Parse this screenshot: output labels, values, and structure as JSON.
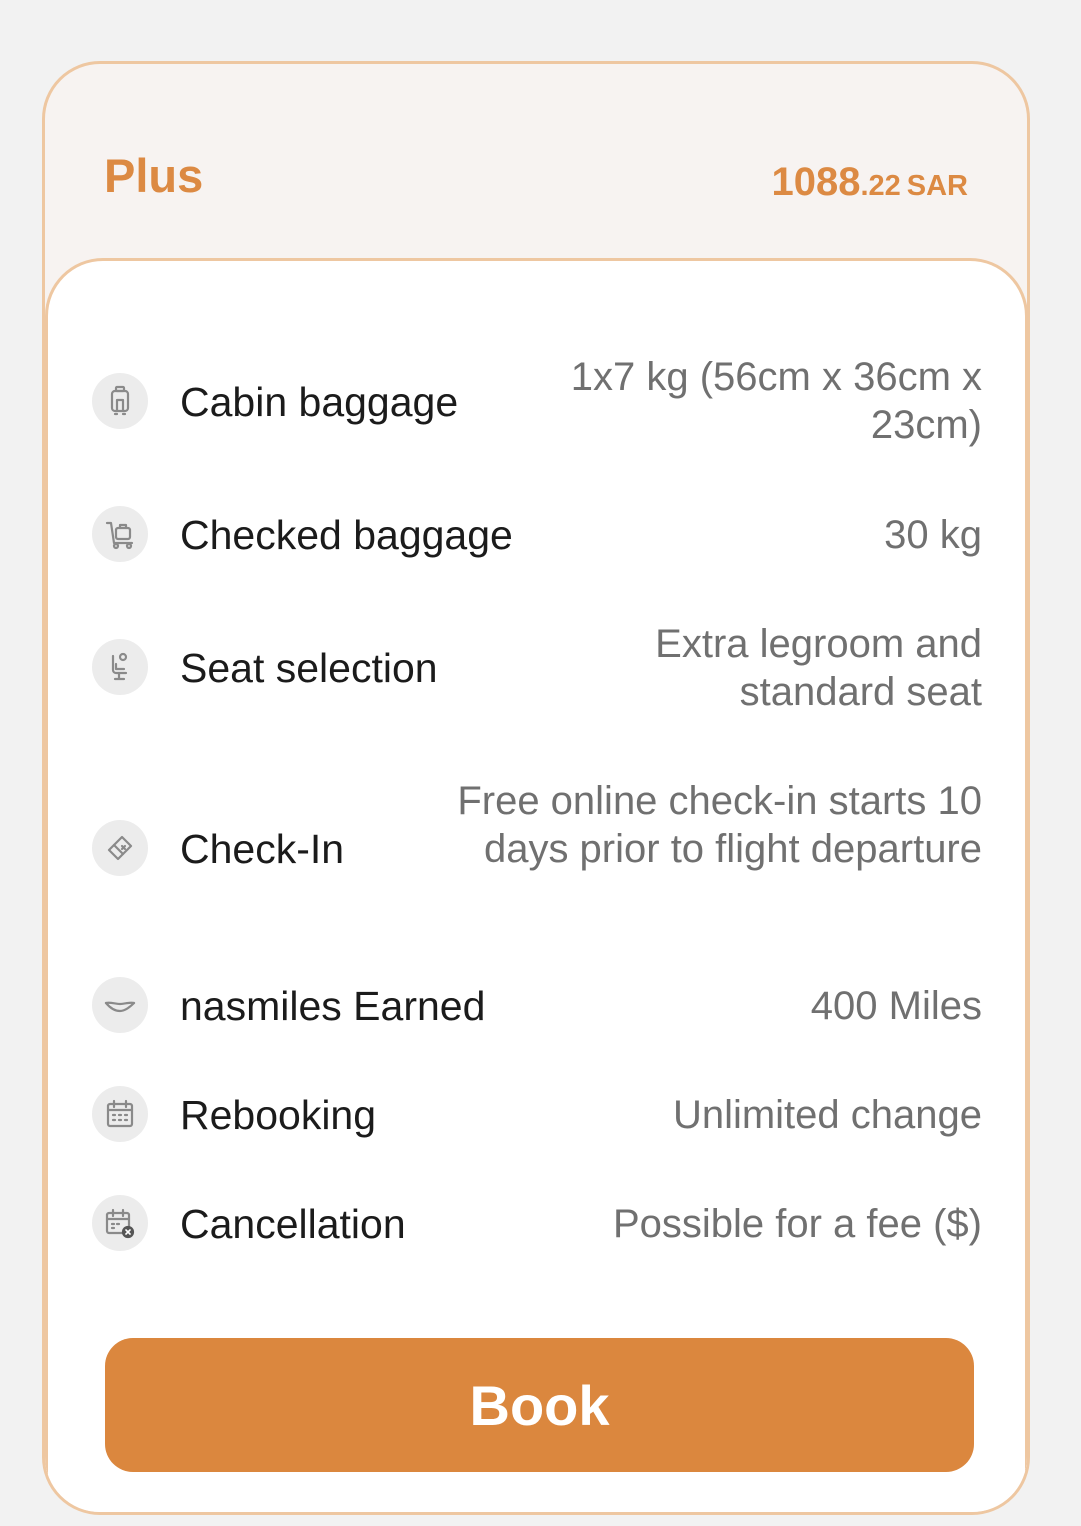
{
  "fare": {
    "name": "Plus",
    "price_integer": "1088",
    "price_decimal": ".22",
    "currency": "SAR"
  },
  "features": [
    {
      "icon": "cabin-bag-icon",
      "label": "Cabin baggage",
      "value": "1x7 kg (56cm x 36cm x 23cm)"
    },
    {
      "icon": "checked-bag-icon",
      "label": "Checked baggage",
      "value": "30 kg"
    },
    {
      "icon": "seat-icon",
      "label": "Seat selection",
      "value": "Extra legroom and standard seat"
    },
    {
      "icon": "ticket-icon",
      "label": "Check-In",
      "value": "Free online check-in starts 10 days prior to flight departure"
    },
    {
      "icon": "smile-icon",
      "label": "nasmiles Earned",
      "value": "400 Miles"
    },
    {
      "icon": "calendar-icon",
      "label": "Rebooking",
      "value": "Unlimited change"
    },
    {
      "icon": "calendar-cancel-icon",
      "label": "Cancellation",
      "value": "Possible for a fee ($)"
    }
  ],
  "book_button": {
    "label": "Book"
  },
  "colors": {
    "accent": "#db873e",
    "card_border": "#eec7a1",
    "header_bg": "#f7f3f1"
  }
}
